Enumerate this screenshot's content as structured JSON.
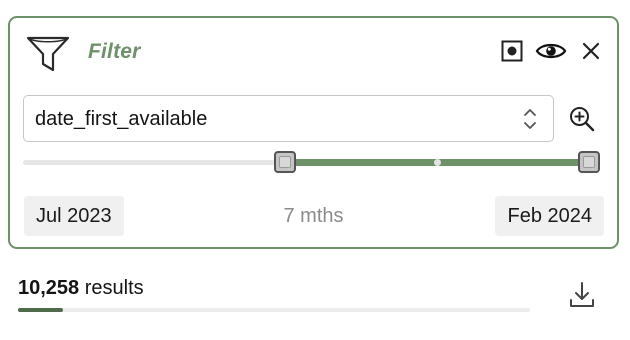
{
  "filter": {
    "title": "Filter",
    "icon": "filter-funnel-icon",
    "header_icons": [
      "record-icon",
      "eye-icon",
      "close-icon"
    ],
    "accent_color": "#6f916a",
    "field": {
      "selected": "date_first_available",
      "icon": "chevron-up-down-icon"
    },
    "zoom_icon": "zoom-in-icon",
    "range": {
      "start_label": "Jul 2023",
      "end_label": "Feb 2024",
      "duration_label": "7 mths",
      "start_fraction": 0.454,
      "end_fraction": 0.983
    }
  },
  "results": {
    "count": "10,258",
    "label": "results",
    "progress_fraction": 0.088,
    "download_icon": "download-icon"
  }
}
